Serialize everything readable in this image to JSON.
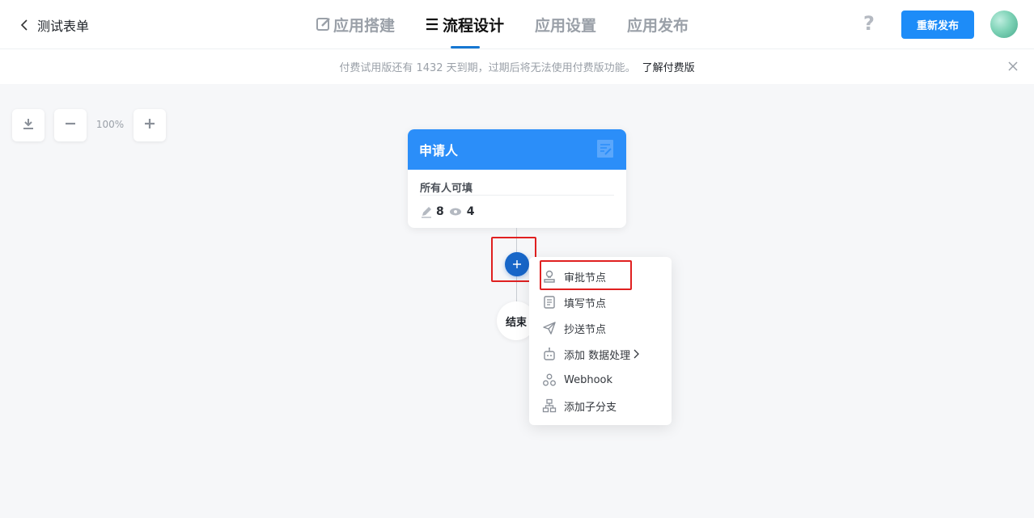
{
  "header": {
    "back_label": "测试表单",
    "tabs": [
      {
        "label": "应用搭建",
        "icon": "edit-icon"
      },
      {
        "label": "流程设计",
        "icon": "flow-icon"
      },
      {
        "label": "应用设置"
      },
      {
        "label": "应用发布"
      }
    ],
    "active_tab": 1,
    "help_label": "?",
    "republish_label": "重新发布"
  },
  "notice": {
    "message": "付费试用版还有 1432 天到期，过期后将无法使用付费版功能。",
    "link": "了解付费版"
  },
  "toolbar": {
    "zoom_level": "100%"
  },
  "applicant_node": {
    "title": "申请人",
    "description": "所有人可填",
    "editable_count": "8",
    "visible_count": "4"
  },
  "end_node": {
    "label": "结束"
  },
  "add_menu": {
    "items": [
      {
        "label": "审批节点",
        "icon": "approver-icon"
      },
      {
        "label": "填写节点",
        "icon": "form-icon"
      },
      {
        "label": "抄送节点",
        "icon": "send-icon"
      },
      {
        "label": "添加 数据处理",
        "icon": "robot-icon",
        "has_submenu": true
      },
      {
        "label": "Webhook",
        "icon": "webhook-icon"
      },
      {
        "label": "添加子分支",
        "icon": "branch-icon"
      }
    ]
  },
  "colors": {
    "accent": "#1d8cf8",
    "card_header": "#2b8ef9",
    "add_button": "#1766c8",
    "highlight": "#e02020"
  }
}
